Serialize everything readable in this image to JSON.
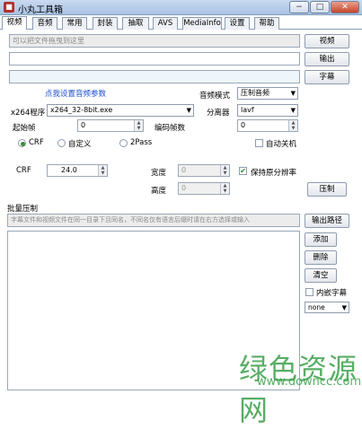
{
  "window": {
    "title": "小丸工具箱",
    "min": "−",
    "max": "□",
    "close": "✕"
  },
  "tabs": [
    {
      "label": "视频"
    },
    {
      "label": "音频"
    },
    {
      "label": "常用"
    },
    {
      "label": "封装"
    },
    {
      "label": "抽取"
    },
    {
      "label": "AVS"
    },
    {
      "label": "MediaInfo"
    },
    {
      "label": "设置"
    },
    {
      "label": "帮助"
    }
  ],
  "video": {
    "input_placeholder": "可以把文件拖曳到这里",
    "video_btn": "视频",
    "output_btn": "输出",
    "subtitle_btn": "字幕",
    "audio_settings_link": "点我设置音频参数",
    "audio_mode_label": "音频模式",
    "audio_mode_value": "压制音频",
    "x264_label": "x264程序",
    "x264_value": "x264_32-8bit.exe",
    "demuxer_label": "分离器",
    "demuxer_value": "lavf",
    "start_frame_label": "起始帧",
    "start_frame_value": "0",
    "encode_frames_label": "编码帧数",
    "encode_frames_value": "0",
    "rate_modes": [
      {
        "label": "CRF",
        "checked": true
      },
      {
        "label": "自定义",
        "checked": false
      },
      {
        "label": "2Pass",
        "checked": false
      }
    ],
    "auto_shutdown_label": "自动关机",
    "crf_label": "CRF",
    "crf_value": "24.0",
    "width_label": "宽度",
    "width_value": "0",
    "height_label": "高度",
    "height_value": "0",
    "keep_resolution_label": "保持原分辨率",
    "encode_btn": "压制"
  },
  "batch": {
    "section_label": "批量压制",
    "hint": "字幕文件和视频文件在同一目录下且同名，不同名仅有语言后缀时请在右方选择或输入",
    "output_path_btn": "输出路径",
    "add_btn": "添加",
    "delete_btn": "删除",
    "clear_btn": "清空",
    "embed_sub_label": "内嵌字幕",
    "sub_lang_value": "none"
  },
  "watermark": {
    "text": "绿色资源网",
    "url": "www.downcc.com"
  },
  "colors": {
    "link": "#1f4fd6",
    "watermark": "#3aa04a",
    "titlebar": "#b9cde9"
  }
}
